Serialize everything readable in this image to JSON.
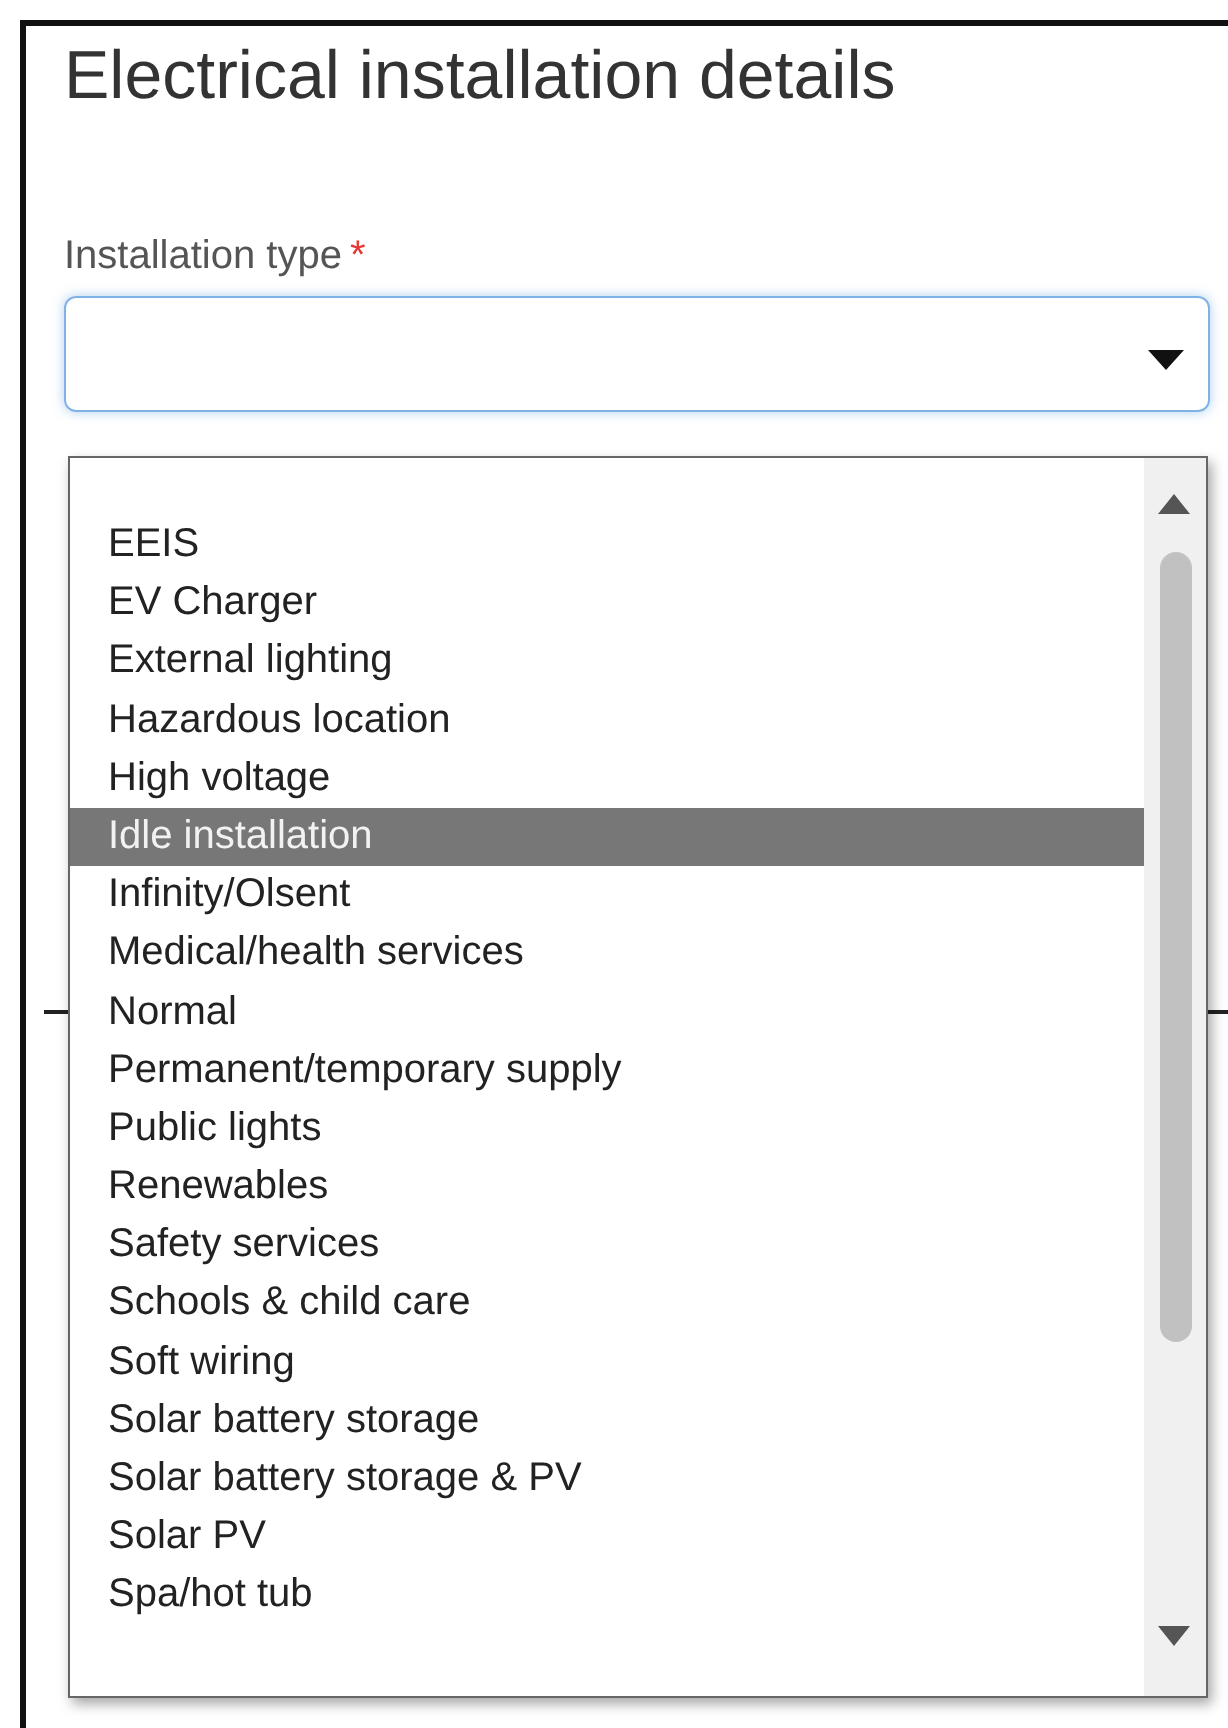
{
  "title": "Electrical installation details",
  "installation_type": {
    "label": "Installation type",
    "required_mark": "*"
  },
  "options": [
    {
      "label": "EEIS",
      "selected": false
    },
    {
      "label": "EV Charger",
      "selected": false
    },
    {
      "label": "External lighting",
      "selected": false
    },
    {
      "label": "Hazardous location",
      "selected": false
    },
    {
      "label": "High voltage",
      "selected": false
    },
    {
      "label": "Idle installation",
      "selected": true
    },
    {
      "label": "Infinity/Olsent",
      "selected": false
    },
    {
      "label": "Medical/health services",
      "selected": false
    },
    {
      "label": "Normal",
      "selected": false
    },
    {
      "label": "Permanent/temporary supply",
      "selected": false
    },
    {
      "label": "Public lights",
      "selected": false
    },
    {
      "label": "Renewables",
      "selected": false
    },
    {
      "label": "Safety services",
      "selected": false
    },
    {
      "label": "Schools & child care",
      "selected": false
    },
    {
      "label": "Soft wiring",
      "selected": false
    },
    {
      "label": "Solar battery storage",
      "selected": false
    },
    {
      "label": "Solar battery storage & PV",
      "selected": false
    },
    {
      "label": "Solar PV",
      "selected": false
    },
    {
      "label": "Spa/hot tub",
      "selected": false
    }
  ]
}
